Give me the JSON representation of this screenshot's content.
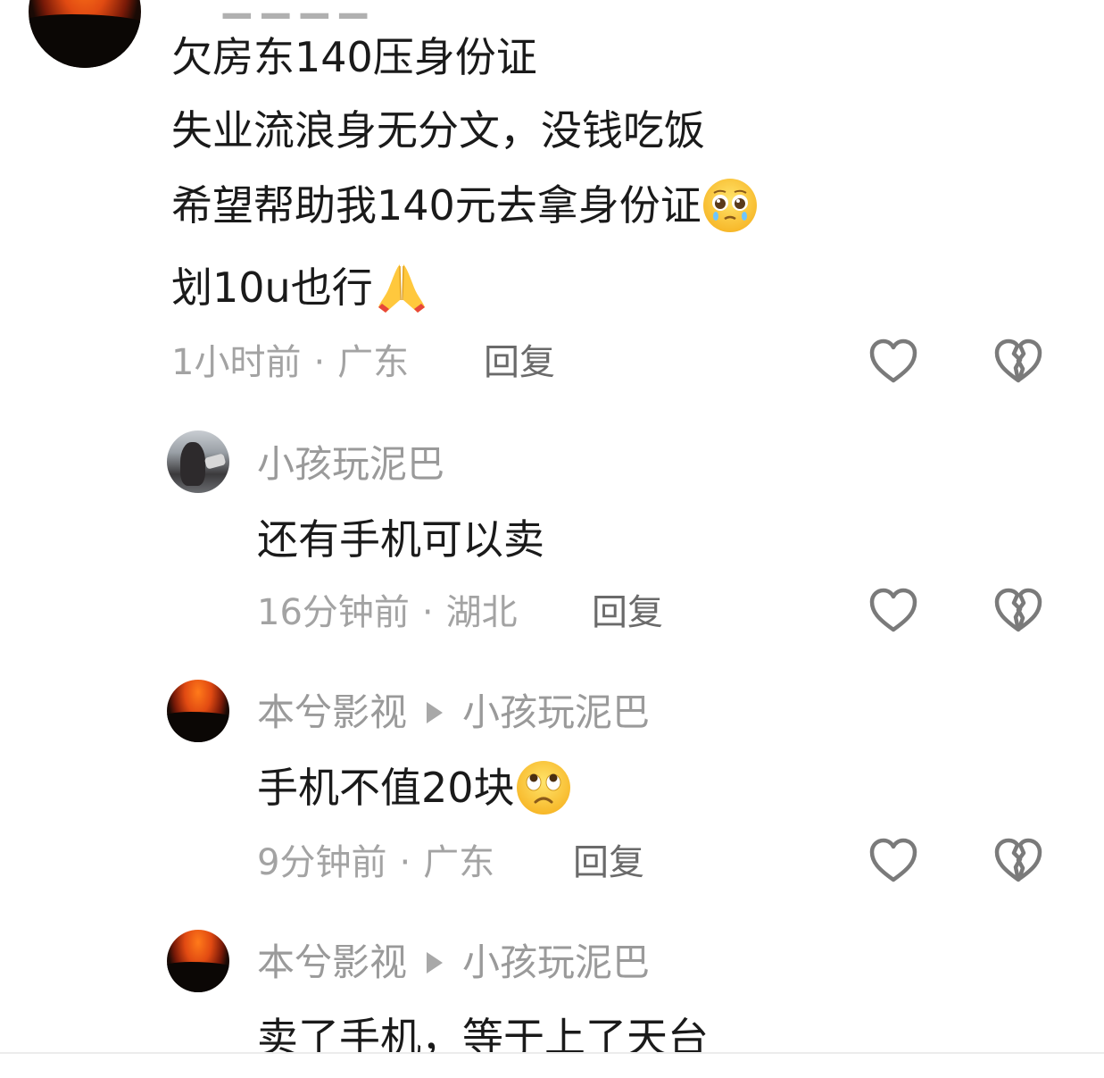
{
  "comments": [
    {
      "lines": [
        "欠房东140压身份证",
        "失业流浪身无分文，没钱吃饭",
        "希望帮助我140元去拿身份证",
        "划10u也行"
      ],
      "emojis": [
        "pleading-face",
        "folded-hands"
      ],
      "time": "1小时前",
      "location": "广东",
      "reply_label": "回复"
    },
    {
      "author": "小孩玩泥巴",
      "text": "还有手机可以卖",
      "time": "16分钟前",
      "location": "湖北",
      "reply_label": "回复"
    },
    {
      "author": "本兮影视",
      "reply_to": "小孩玩泥巴",
      "text": "手机不值20块",
      "emoji": "frowning-face-rolling-eyes",
      "time": "9分钟前",
      "location": "广东",
      "reply_label": "回复"
    },
    {
      "author": "本兮影视",
      "reply_to": "小孩玩泥巴",
      "text": "卖了手机，等于上了天台"
    }
  ],
  "separator": "·",
  "icons": {
    "like": "heart-outline-icon",
    "dislike": "broken-heart-outline-icon"
  },
  "colors": {
    "text": "#1a1a1a",
    "muted": "#a3a3a3",
    "reply": "#6a6a6a",
    "icon": "#7a7a7a"
  }
}
